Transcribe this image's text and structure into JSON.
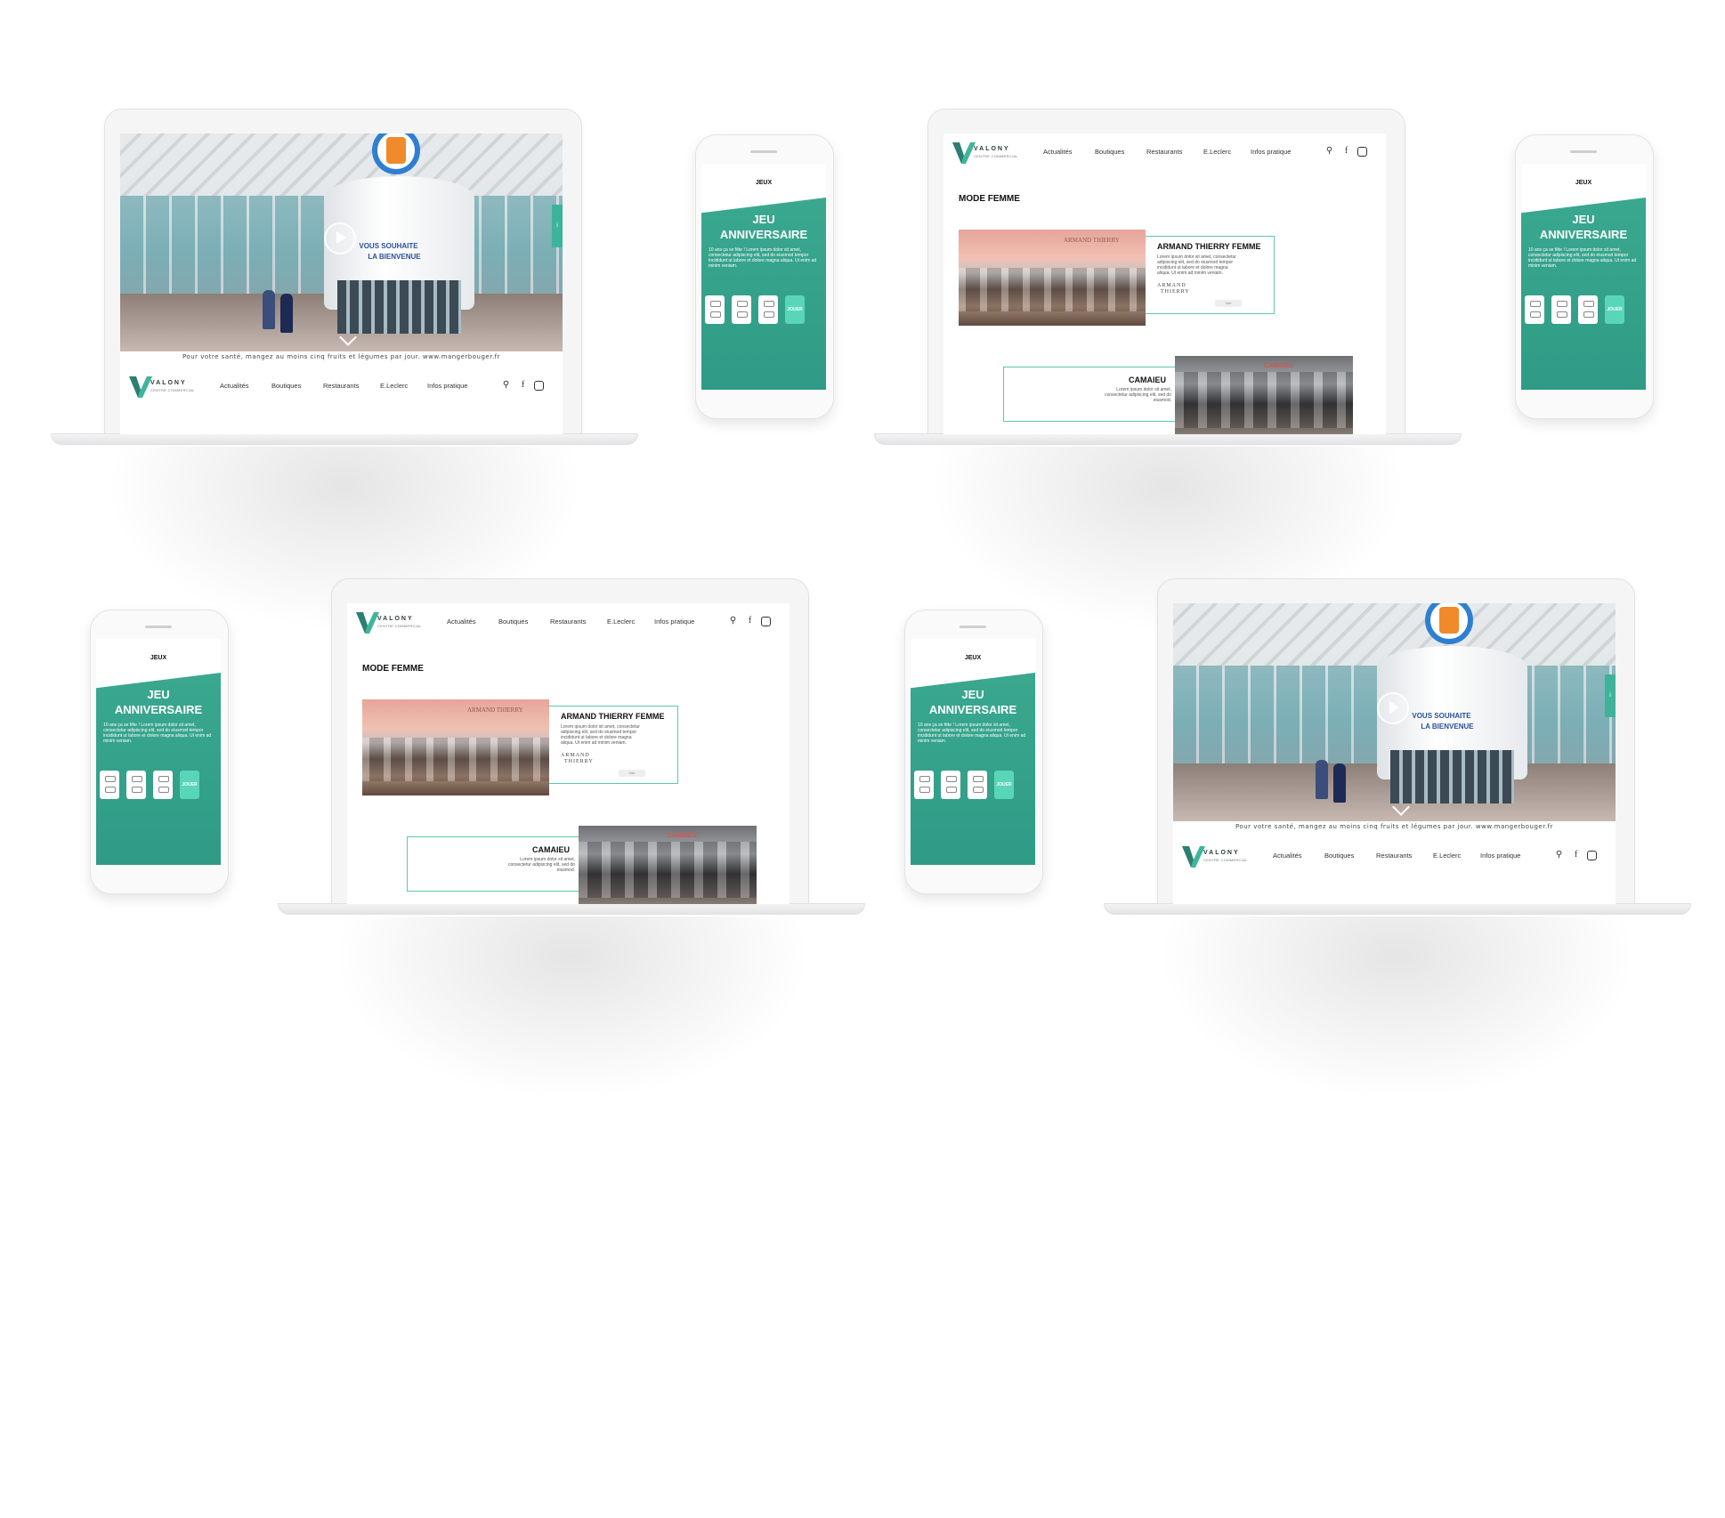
{
  "colors": {
    "accent": "#43c3a6",
    "accent_dark": "#2f9b86",
    "text": "#111111",
    "device_shell": "#f5f5f6",
    "background": "#ffffff"
  },
  "brand": {
    "name": "VALONY",
    "subtitle": "CENTRE COMMERCIAL"
  },
  "nav": {
    "items": [
      "Actualités",
      "Boutiques",
      "Restaurants",
      "E.Leclerc",
      "Infos pratique"
    ],
    "icons": [
      "search-icon",
      "facebook-icon",
      "instagram-icon"
    ]
  },
  "home": {
    "sign_line1": "VOUS SOUHAITE",
    "sign_line2": "LA BIENVENUE",
    "slogan": "Pour votre santé, mangez au moins cinq fruits et légumes par jour.   www.mangerbouger.fr",
    "active_nav": "Actualités"
  },
  "boutiques": {
    "active_nav": "Boutiques",
    "section_title": "MODE FEMME",
    "shop1": {
      "name": "ARMAND THIERRY FEMME",
      "lorem": "Lorem ipsum dolor sit amet, consectetur adipiscing elit, sed do eiusmod tempor incididunt ut labore et dolore magna aliqua. Ut enim ad minim veniam.",
      "logo_line1": "ARMAND",
      "logo_line2": "THIERRY",
      "photo_sign": "ARMAND THIERRY",
      "button": "Voir"
    },
    "shop2": {
      "name": "CAMAIEU",
      "lorem": "Lorem ipsum dolor sit amet, consectetur adipiscing elit, sed do eiusmod.",
      "photo_sign": "CAMAIEU"
    }
  },
  "game": {
    "tag": "JEUX",
    "title_line1": "JEU",
    "title_line2": "ANNIVERSAIRE",
    "text": "10 ans ça se fête ! Lorem ipsum dolor sit amet, consectetur adipiscing elit, sed do eiusmod tempor incididunt ut labore et dolore magna aliqua. Ut enim ad minim veniam.",
    "button": "JOUER"
  }
}
